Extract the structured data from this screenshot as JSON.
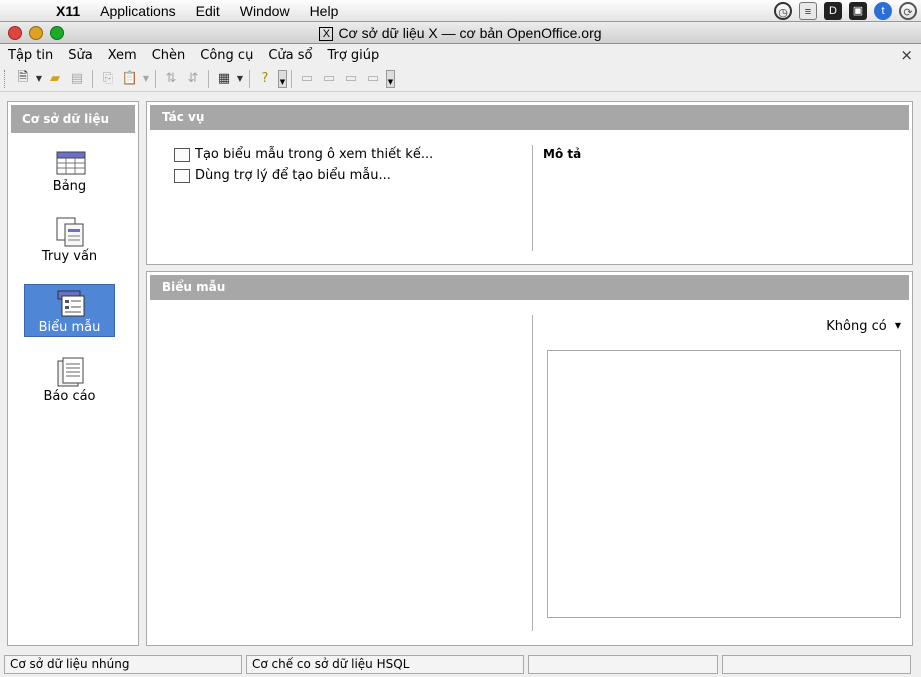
{
  "mac_menubar": {
    "app_name": "X11",
    "items": [
      "Applications",
      "Edit",
      "Window",
      "Help"
    ]
  },
  "window": {
    "title": "Cơ sở dữ liệu X — cơ bản OpenOffice.org",
    "badge": "X"
  },
  "menu": {
    "items": [
      "Tập tin",
      "Sửa",
      "Xem",
      "Chèn",
      "Công cụ",
      "Cửa sổ",
      "Trợ giúp"
    ],
    "close_doc": "×"
  },
  "sidebar": {
    "header": "Cơ sở dữ liệu",
    "items": [
      {
        "label": "Bảng",
        "icon": "table-icon"
      },
      {
        "label": "Truy vấn",
        "icon": "query-icon"
      },
      {
        "label": "Biểu mẫu",
        "icon": "form-icon",
        "selected": true
      },
      {
        "label": "Báo cáo",
        "icon": "report-icon"
      }
    ]
  },
  "tasks": {
    "header": "Tác vụ",
    "items": [
      {
        "label": "Tạo biểu mẫu trong ô xem thiết kế...",
        "icon": "design-view-icon"
      },
      {
        "label": "Dùng trợ lý để tạo biểu mẫu...",
        "icon": "wizard-icon"
      }
    ],
    "description_label": "Mô tả"
  },
  "forms": {
    "header": "Biểu mẫu",
    "preview_mode": "Không có"
  },
  "statusbar": {
    "cells": [
      "Cơ sở dữ liệu nhúng",
      "Cơ chế co sở dữ liệu HSQL",
      "",
      ""
    ]
  },
  "colors": {
    "selected": "#4f86d6",
    "panel_header": "#a7a7a7"
  }
}
